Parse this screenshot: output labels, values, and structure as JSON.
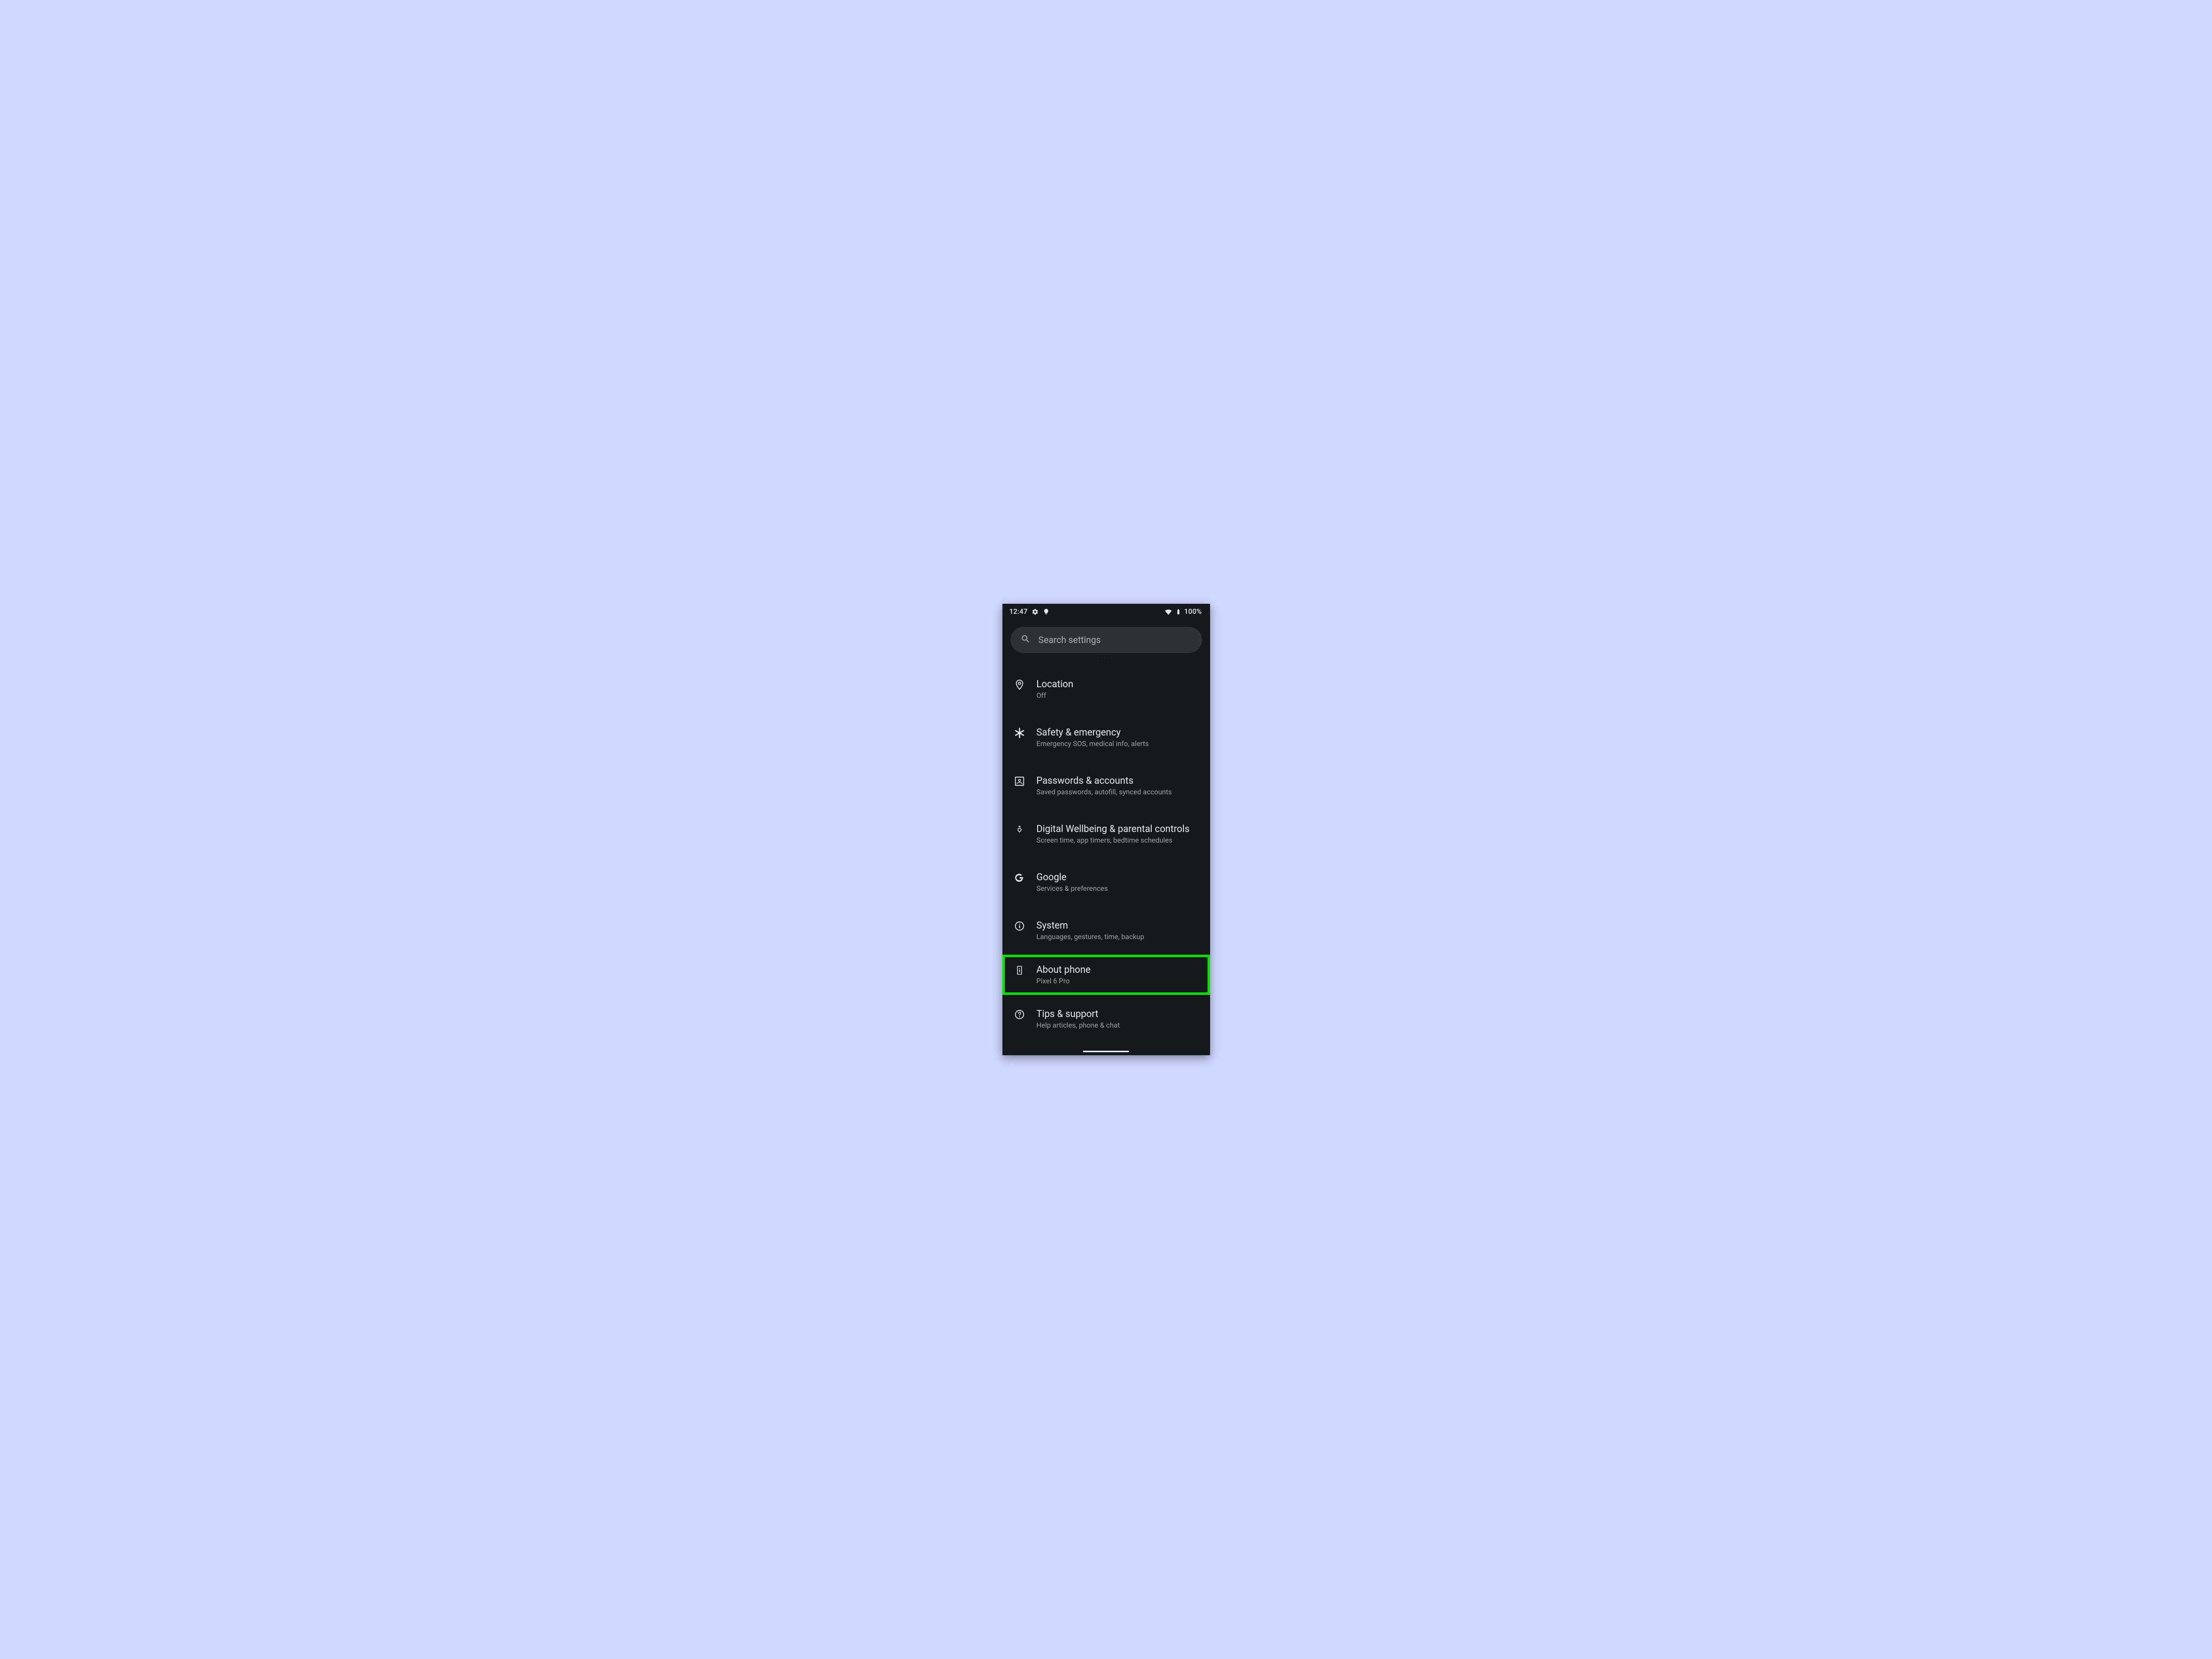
{
  "status": {
    "time": "12:47",
    "battery_text": "100%"
  },
  "search": {
    "placeholder": "Search settings"
  },
  "items": [
    {
      "icon": "location-pin-icon",
      "title": "Location",
      "sub": "Off"
    },
    {
      "icon": "asterisk-icon",
      "title": "Safety & emergency",
      "sub": "Emergency SOS, medical info, alerts"
    },
    {
      "icon": "account-box-icon",
      "title": "Passwords & accounts",
      "sub": "Saved passwords, autofill, synced accounts"
    },
    {
      "icon": "wellbeing-icon",
      "title": "Digital Wellbeing & parental controls",
      "sub": "Screen time, app timers, bedtime schedules"
    },
    {
      "icon": "google-g-icon",
      "title": "Google",
      "sub": "Services & preferences"
    },
    {
      "icon": "info-circle-icon",
      "title": "System",
      "sub": "Languages, gestures, time, backup"
    },
    {
      "icon": "phone-about-icon",
      "title": "About phone",
      "sub": "Pixel 6 Pro"
    },
    {
      "icon": "help-circle-icon",
      "title": "Tips & support",
      "sub": "Help articles, phone & chat"
    }
  ],
  "highlight_index": 6
}
